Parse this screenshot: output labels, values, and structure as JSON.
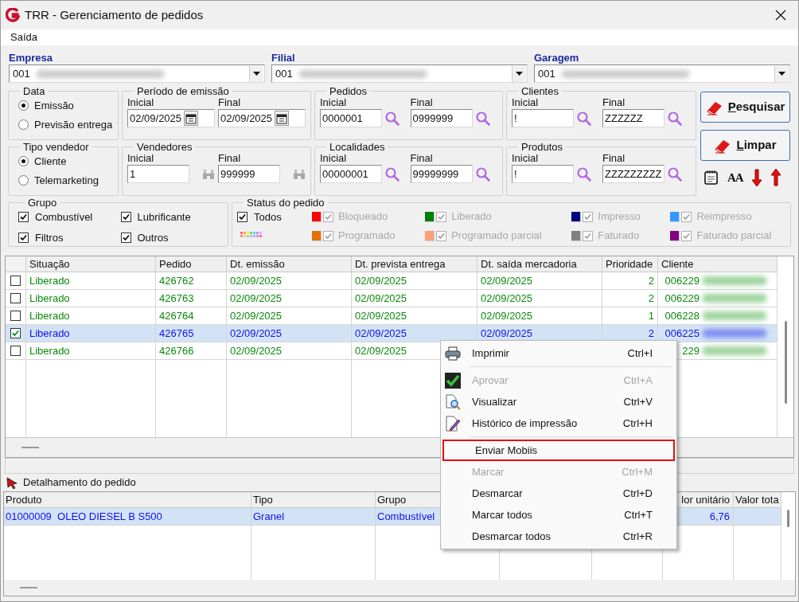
{
  "window": {
    "title": "TRR - Gerenciamento de pedidos"
  },
  "menu": [
    "Saída"
  ],
  "selectors": [
    {
      "label": "Empresa",
      "value": "001"
    },
    {
      "label": "Filial",
      "value": "001"
    },
    {
      "label": "Garagem",
      "value": "001"
    }
  ],
  "filter_rows": [
    {
      "radio_group": {
        "title": "Data",
        "options": [
          {
            "label": "Emissão",
            "selected": true
          },
          {
            "label": "Previsão entrega",
            "selected": false
          }
        ]
      },
      "ranges": [
        {
          "title": "Período de emissão",
          "kind": "date",
          "fields": [
            {
              "label": "Inicial",
              "value": "02/09/2025"
            },
            {
              "label": "Final",
              "value": "02/09/2025"
            }
          ]
        },
        {
          "title": "Pedidos",
          "kind": "search",
          "fields": [
            {
              "label": "Inicial",
              "value": "0000001"
            },
            {
              "label": "Final",
              "value": "0999999"
            }
          ]
        },
        {
          "title": "Clientes",
          "kind": "search",
          "fields": [
            {
              "label": "Inicial",
              "value": "!"
            },
            {
              "label": "Final",
              "value": "ZZZZZZ"
            }
          ]
        }
      ]
    },
    {
      "radio_group": {
        "title": "Tipo vendedor",
        "options": [
          {
            "label": "Cliente",
            "selected": true
          },
          {
            "label": "Telemarketing",
            "selected": false
          }
        ]
      },
      "ranges": [
        {
          "title": "Vendedores",
          "kind": "lookup",
          "fields": [
            {
              "label": "Inicial",
              "value": "1"
            },
            {
              "label": "Final",
              "value": "999999"
            }
          ]
        },
        {
          "title": "Localidades",
          "kind": "search",
          "fields": [
            {
              "label": "Inicial",
              "value": "00000001"
            },
            {
              "label": "Final",
              "value": "99999999"
            }
          ]
        },
        {
          "title": "Produtos",
          "kind": "search",
          "fields": [
            {
              "label": "Inicial",
              "value": "!"
            },
            {
              "label": "Final",
              "value": "ZZZZZZZZZ"
            }
          ]
        }
      ]
    }
  ],
  "buttons": [
    {
      "label": "Pesquisar"
    },
    {
      "label": "Limpar"
    }
  ],
  "toolbar": [
    {
      "kind": "notes"
    },
    {
      "kind": "font",
      "text": "AA"
    },
    {
      "kind": "down"
    },
    {
      "kind": "up"
    }
  ],
  "grupo": {
    "title": "Grupo",
    "items": [
      {
        "label": "Combustível",
        "checked": true
      },
      {
        "label": "Lubrificante",
        "checked": true
      },
      {
        "label": "Filtros",
        "checked": true
      },
      {
        "label": "Outros",
        "checked": true
      }
    ]
  },
  "status": {
    "title": "Status do pedido",
    "all": {
      "label": "Todos",
      "checked": true
    },
    "items": [
      {
        "label": "Bloqueado",
        "color": "#ff0000",
        "checked": true,
        "disabled": true
      },
      {
        "label": "Programado",
        "color": "#e8700a",
        "checked": true,
        "disabled": true
      },
      {
        "label": "Liberado",
        "color": "#008000",
        "checked": true,
        "disabled": true
      },
      {
        "label": "Programado parcial",
        "color": "#ffa07a",
        "checked": true,
        "disabled": true
      },
      {
        "label": "Impresso",
        "color": "#000080",
        "checked": true,
        "disabled": true
      },
      {
        "label": "Faturado",
        "color": "#808080",
        "checked": true,
        "disabled": true
      },
      {
        "label": "Reimpresso",
        "color": "#3399ff",
        "checked": true,
        "disabled": true
      },
      {
        "label": "Faturado parcial",
        "color": "#800080",
        "checked": true,
        "disabled": true
      }
    ]
  },
  "orders": {
    "columns": [
      "Situação",
      "Pedido",
      "Dt. emissão",
      "Dt. prevista entrega",
      "Dt. saída mercadoria",
      "Prioridade",
      "Cliente"
    ],
    "rows": [
      {
        "checked": false,
        "selected": false,
        "cells": [
          "Liberado",
          "426762",
          "02/09/2025",
          "02/09/2025",
          "02/09/2025",
          "2",
          "006229"
        ]
      },
      {
        "checked": false,
        "selected": false,
        "cells": [
          "Liberado",
          "426763",
          "02/09/2025",
          "02/09/2025",
          "02/09/2025",
          "2",
          "006229"
        ]
      },
      {
        "checked": false,
        "selected": false,
        "cells": [
          "Liberado",
          "426764",
          "02/09/2025",
          "02/09/2025",
          "02/09/2025",
          "1",
          "006228"
        ]
      },
      {
        "checked": true,
        "selected": true,
        "cells": [
          "Liberado",
          "426765",
          "02/09/2025",
          "02/09/2025",
          "02/09/2025",
          "2",
          "006225"
        ]
      },
      {
        "checked": false,
        "selected": false,
        "cells": [
          "Liberado",
          "426766",
          "02/09/2025",
          "02/09/2025",
          null,
          null,
          "229"
        ]
      }
    ]
  },
  "detail": {
    "title": "Detalhamento do pedido",
    "columns": [
      "Produto",
      "Tipo",
      "Grupo",
      null,
      null,
      "lor unitário",
      "Valor tota"
    ],
    "rows": [
      {
        "selected": true,
        "cells": [
          "01000009  OLEO DIESEL B S500",
          "Granel",
          "Combustível",
          null,
          null,
          "6,76",
          null
        ]
      }
    ]
  },
  "context_menu": {
    "sections": [
      [
        {
          "label": "Imprimir",
          "shortcut": "Ctrl+I",
          "kind": "print",
          "disabled": false,
          "highlighted": false
        }
      ],
      [
        {
          "label": "Aprovar",
          "shortcut": "Ctrl+A",
          "kind": "approve",
          "disabled": true,
          "highlighted": false
        },
        {
          "label": "Visualizar",
          "shortcut": "Ctrl+V",
          "kind": "preview",
          "disabled": false,
          "highlighted": false
        },
        {
          "label": "Histórico de impressão",
          "shortcut": "Ctrl+H",
          "kind": "history",
          "disabled": false,
          "highlighted": false
        }
      ],
      [
        {
          "label": "Enviar Mobiis",
          "kind": "plain",
          "disabled": false,
          "highlighted": true
        },
        {
          "label": "Marcar",
          "shortcut": "Ctrl+M",
          "kind": "plain",
          "disabled": true,
          "highlighted": false
        },
        {
          "label": "Desmarcar",
          "shortcut": "Ctrl+D",
          "kind": "plain",
          "disabled": false,
          "highlighted": false
        },
        {
          "label": "Marcar todos",
          "shortcut": "Ctrl+T",
          "kind": "plain",
          "disabled": false,
          "highlighted": false
        },
        {
          "label": "Desmarcar todos",
          "shortcut": "Ctrl+R",
          "kind": "plain",
          "disabled": false,
          "highlighted": false
        }
      ]
    ]
  }
}
